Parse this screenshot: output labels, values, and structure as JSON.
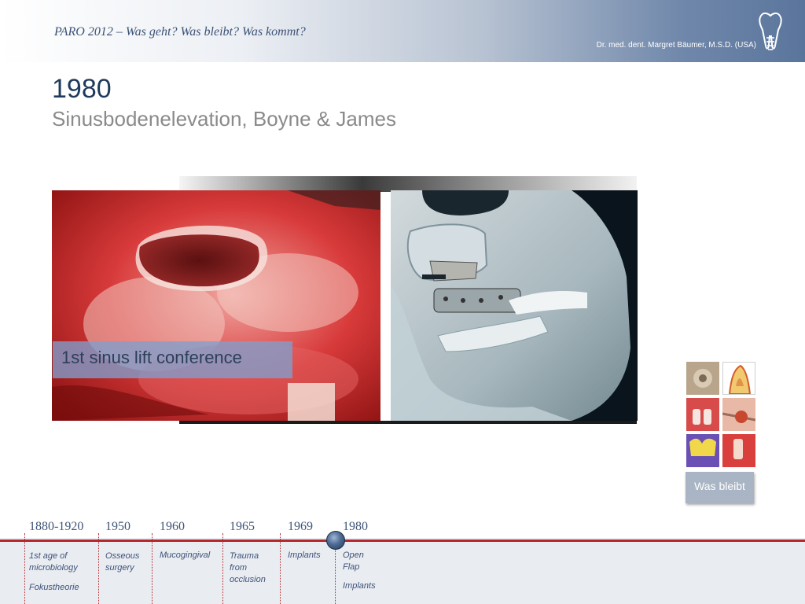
{
  "header": {
    "title": "PARO 2012 – Was geht? Was bleibt? Was kommt?",
    "author": "Dr. med. dent. Margret Bäumer, M.S.D. (USA)"
  },
  "slide": {
    "year": "1980",
    "subtitle": "Sinusbodenelevation, Boyne & James"
  },
  "caption": "1st sinus lift conference",
  "badge": "Was bleibt",
  "timeline": {
    "years": [
      "1880-1920",
      "1950",
      "1960",
      "1965",
      "1969",
      "1980"
    ],
    "labels": {
      "period_1880": [
        "1st age of",
        "microbiology"
      ],
      "period_1880_sub": "Fokustheorie",
      "period_1950": [
        "Osseous",
        "surgery"
      ],
      "period_1960": "Mucogingival",
      "period_1965": [
        "Trauma",
        "from",
        "occlusion"
      ],
      "period_1969": "Implants",
      "period_1980": [
        "Open",
        "Flap"
      ],
      "period_1980_sub": "Implants"
    }
  },
  "icons": {
    "logo": "tooth-implant-icon",
    "timeline_marker": "timeline-marker-icon"
  },
  "colors": {
    "accent_red": "#b5272d",
    "navy": "#1f3a5c",
    "caption_bg": "#809fcd"
  }
}
